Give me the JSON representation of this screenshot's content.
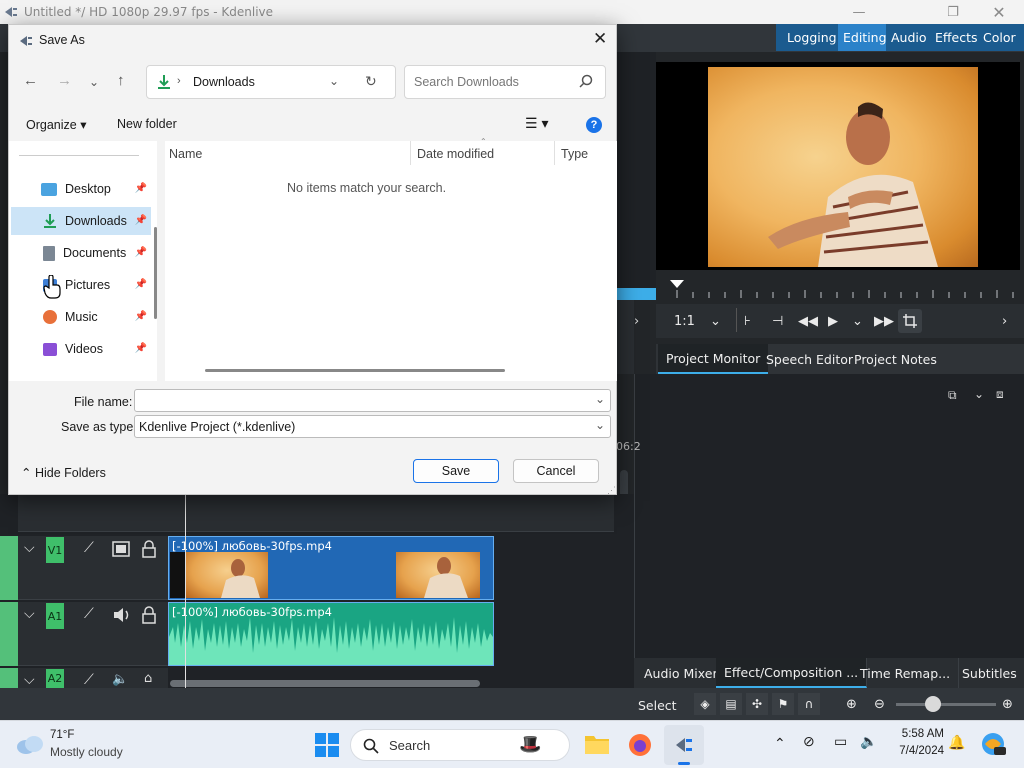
{
  "window": {
    "title": "Untitled */ HD 1080p 29.97 fps - Kdenlive"
  },
  "workspaces": [
    "Logging",
    "Editing",
    "Audio",
    "Effects",
    "Color"
  ],
  "monitor": {
    "zoom": "1:1",
    "tabs": [
      "Project Monitor",
      "Speech Editor",
      "Project Notes"
    ],
    "partial_timecode": "06:2"
  },
  "bottom_tabs": [
    "Audio Mixer",
    "Effect/Composition ...",
    "Time Remap...",
    "Subtitles"
  ],
  "status": {
    "mode": "Select"
  },
  "timeline": {
    "tracks": [
      {
        "name": "V1",
        "clip": "[-100%] любовь-30fps.mp4"
      },
      {
        "name": "A1",
        "clip": "[-100%] любовь-30fps.mp4"
      },
      {
        "name": "A2"
      }
    ]
  },
  "dialog": {
    "title": "Save As",
    "address": "Downloads",
    "search_placeholder": "Search Downloads",
    "organize": "Organize",
    "new_folder": "New folder",
    "nav_items": [
      "Desktop",
      "Downloads",
      "Documents",
      "Pictures",
      "Music",
      "Videos"
    ],
    "selected_nav": "Downloads",
    "columns": [
      "Name",
      "Date modified",
      "Type"
    ],
    "empty_message": "No items match your search.",
    "file_name_label": "File name:",
    "file_name_value": "",
    "save_type_label": "Save as type:",
    "save_type_value": "Kdenlive Project (*.kdenlive)",
    "hide_folders": "Hide Folders",
    "save": "Save",
    "cancel": "Cancel"
  },
  "taskbar": {
    "weather_temp": "71°F",
    "weather_desc": "Mostly cloudy",
    "search": "Search",
    "time": "5:58 AM",
    "date": "7/4/2024"
  },
  "colors": {
    "accent": "#3daee9",
    "workspace_active": "#2b82c9",
    "track_green": "#3fbf6a",
    "audio_clip": "#1aa583",
    "video_clip": "#2168b5"
  }
}
